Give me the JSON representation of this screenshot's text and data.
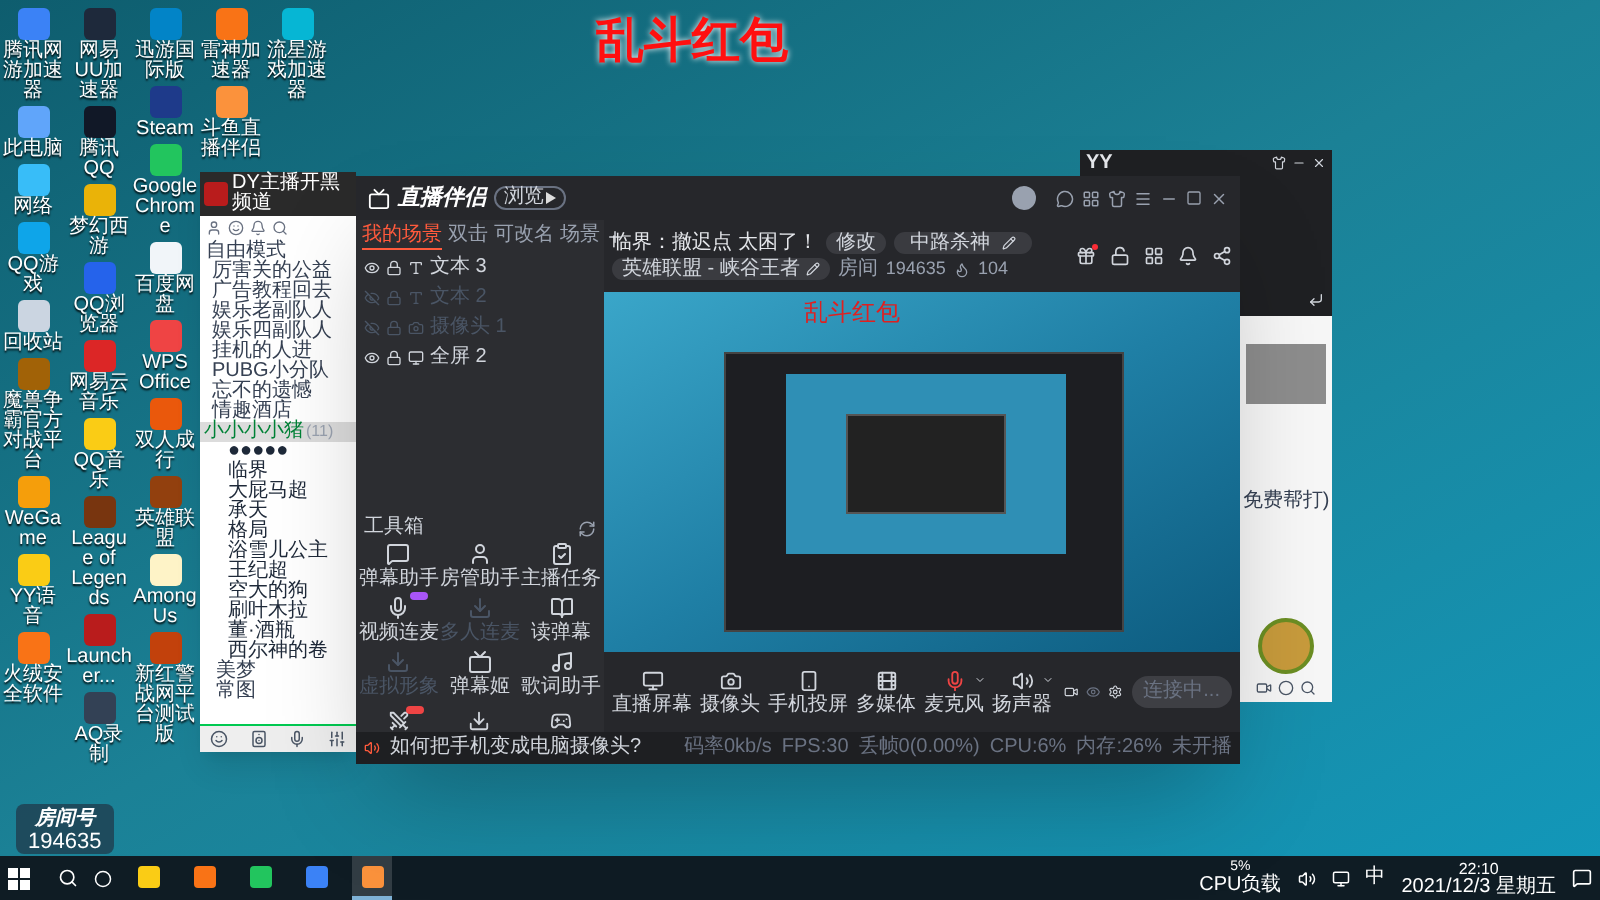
{
  "title": "乱斗红包",
  "desktop_columns": [
    {
      "icons": [
        {
          "label": "腾讯网游加速器",
          "color": "#3b82f6"
        },
        {
          "label": "此电脑",
          "color": "#60a5fa"
        },
        {
          "label": "网络",
          "color": "#38bdf8"
        },
        {
          "label": "QQ游戏",
          "color": "#0ea5e9"
        },
        {
          "label": "回收站",
          "color": "#cbd5e1"
        },
        {
          "label": "魔兽争霸官方对战平台",
          "color": "#a16207"
        },
        {
          "label": "WeGame",
          "color": "#f59e0b"
        },
        {
          "label": "YY语音",
          "color": "#facc15"
        },
        {
          "label": "火绒安全软件",
          "color": "#f97316"
        }
      ]
    },
    {
      "icons": [
        {
          "label": "网易UU加速器",
          "color": "#1e293b"
        },
        {
          "label": "腾讯QQ",
          "color": "#111827"
        },
        {
          "label": "梦幻西游",
          "color": "#eab308"
        },
        {
          "label": "QQ浏览器",
          "color": "#2563eb"
        },
        {
          "label": "网易云音乐",
          "color": "#dc2626"
        },
        {
          "label": "QQ音乐",
          "color": "#facc15"
        },
        {
          "label": "League of Legends",
          "color": "#78350f"
        },
        {
          "label": "Launcher...",
          "color": "#b91c1c"
        },
        {
          "label": "AQ录制",
          "color": "#334155"
        }
      ]
    },
    {
      "icons": [
        {
          "label": "迅游国际版",
          "color": "#0284c7"
        },
        {
          "label": "Steam",
          "color": "#1e3a8a"
        },
        {
          "label": "Google Chrome",
          "color": "#22c55e"
        },
        {
          "label": "百度网盘",
          "color": "#f1f5f9"
        },
        {
          "label": "WPS Office",
          "color": "#ef4444"
        },
        {
          "label": "双人成行",
          "color": "#ea580c"
        },
        {
          "label": "英雄联盟",
          "color": "#92400e"
        },
        {
          "label": "Among Us",
          "color": "#fef3c7"
        },
        {
          "label": "新红警战网平台测试版",
          "color": "#c2410c"
        }
      ]
    },
    {
      "icons": [
        {
          "label": "雷神加速器",
          "color": "#f97316"
        },
        {
          "label": "斗鱼直播伴侣",
          "color": "#fb923c"
        }
      ]
    },
    {
      "icons": [
        {
          "label": "流星游戏加速器",
          "color": "#06b6d4"
        }
      ]
    }
  ],
  "room_overlay": {
    "label": "房间号",
    "number": "194635"
  },
  "yy_channel": {
    "title": "DY主播开黑频道",
    "mode": "自由模式",
    "channels": [
      "厉害关的公益",
      "广告教程回去",
      "娱乐老副队人",
      "娱乐四副队人",
      "挂机的人进",
      "PUBG小分队",
      "忘不的遗憾",
      "情趣酒店"
    ],
    "group": {
      "name": "小小小小猪",
      "count": "(11)",
      "selected": true
    },
    "members": [
      "●●●●●",
      "临界",
      "大屁马超",
      "承天",
      "格局",
      "浴雪儿公主",
      "王纪超",
      "空大的狗",
      "刷叶木拉",
      "董·酒瓶",
      "西尔神的卷"
    ],
    "subchannels": [
      "美梦",
      "常图"
    ]
  },
  "streamer": {
    "app": {
      "name": "直播伴侣",
      "badge": "浏览"
    },
    "scene_tabs": [
      {
        "label": "我的场景",
        "selected": true
      },
      {
        "label": "双击",
        "selected": false
      },
      {
        "label": "可改名",
        "selected": false
      },
      {
        "label": "场景",
        "selected": false
      }
    ],
    "sources": [
      {
        "label": "文本 3",
        "kind": "text",
        "visible": true
      },
      {
        "label": "文本 2",
        "kind": "text",
        "visible": false
      },
      {
        "label": "摄像头 1",
        "kind": "camera",
        "visible": false
      },
      {
        "label": "全屏 2",
        "kind": "screen",
        "visible": true
      }
    ],
    "toolbox": {
      "title": "工具箱",
      "tools": [
        {
          "label": "弹幕助手",
          "kind": "danmu",
          "disabled": false
        },
        {
          "label": "房管助手",
          "kind": "admin",
          "disabled": false
        },
        {
          "label": "主播任务",
          "kind": "task",
          "disabled": false
        },
        {
          "label": "视频连麦",
          "kind": "mic",
          "disabled": false,
          "color": "#a855f7"
        },
        {
          "label": "多人连麦",
          "kind": "download",
          "disabled": true
        },
        {
          "label": "读弹幕",
          "kind": "read",
          "disabled": false
        },
        {
          "label": "虚拟形象",
          "kind": "download",
          "disabled": true
        },
        {
          "label": "弹幕姬",
          "kind": "tv",
          "disabled": false
        },
        {
          "label": "歌词助手",
          "kind": "lyrics",
          "disabled": false
        }
      ],
      "more_tools": [
        {
          "kind": "pk",
          "color": "#ef4444"
        },
        {
          "kind": "download"
        },
        {
          "kind": "game"
        }
      ]
    },
    "room": {
      "title": "临界：撤迟点 太困了！",
      "edit": "修改",
      "tag": "中路杀神",
      "category": "英雄联盟 - 峡谷王者",
      "room_label": "房间",
      "room_id": "194635",
      "viewers": "104"
    },
    "preview": {
      "caption": "乱斗红包"
    },
    "controls": [
      {
        "label": "直播屏幕",
        "kind": "screen",
        "active": false,
        "dropdown": false
      },
      {
        "label": "摄像头",
        "kind": "camera",
        "active": false,
        "dropdown": false
      },
      {
        "label": "手机投屏",
        "kind": "phone",
        "active": false,
        "dropdown": false
      },
      {
        "label": "多媒体",
        "kind": "media",
        "active": false,
        "dropdown": false
      },
      {
        "label": "麦克风",
        "kind": "mic",
        "active": true,
        "dropdown": true
      },
      {
        "label": "扬声器",
        "kind": "speaker",
        "active": false,
        "dropdown": true
      }
    ],
    "start_button": {
      "label": "连接中...",
      "disabled": true
    },
    "tip": "如何把手机变成电脑摄像头?",
    "stats": [
      "码率0kb/s",
      "FPS:30",
      "丢帧0(0.00%)",
      "CPU:6%",
      "内存:26%",
      "未开播"
    ]
  },
  "yy_chat": {
    "title": "YY",
    "message": "免费帮打)"
  },
  "taskbar": {
    "apps": [
      {
        "color": "#facc15",
        "selected": false
      },
      {
        "color": "#f97316",
        "selected": false
      },
      {
        "color": "#22c55e",
        "selected": false
      },
      {
        "color": "#3b82f6",
        "selected": false
      },
      {
        "color": "#fb923c",
        "selected": true
      }
    ],
    "cpu": "5%",
    "cpu_label": "CPU负载",
    "ime": "中",
    "time": "22:10",
    "date": "2021/12/3 星期五"
  }
}
